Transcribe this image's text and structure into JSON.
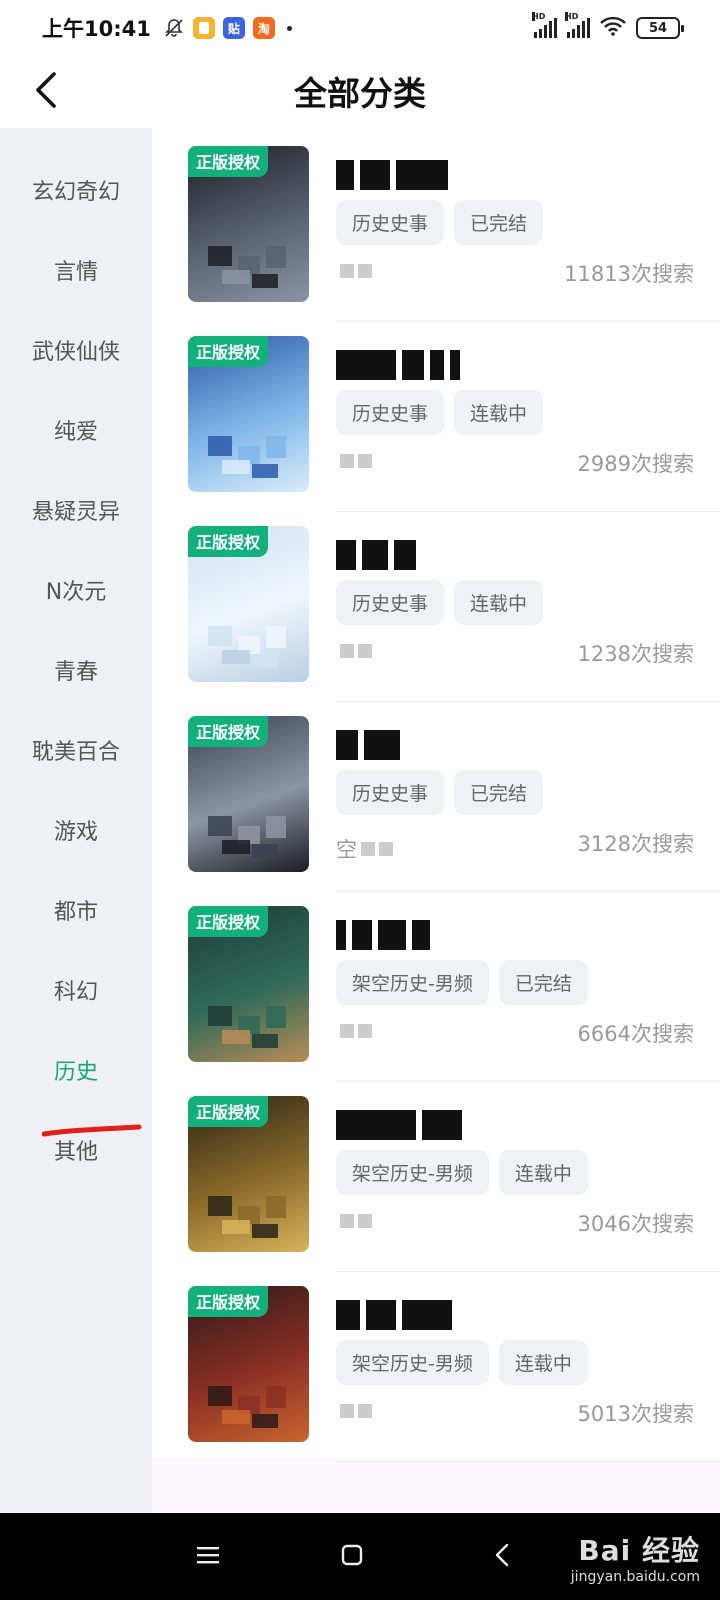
{
  "status_bar": {
    "time": "上午10:41",
    "app_icons": [
      {
        "name": "notes-app-icon",
        "label": "",
        "color": "#f6b531"
      },
      {
        "name": "tieba-app-icon",
        "label": "贴",
        "color": "#3d63e0"
      },
      {
        "name": "taobao-app-icon",
        "label": "淘",
        "color": "#f26b1d"
      }
    ],
    "battery": "54"
  },
  "header": {
    "title": "全部分类"
  },
  "sidebar": {
    "items": [
      {
        "label": "玄幻奇幻",
        "active": false
      },
      {
        "label": "言情",
        "active": false
      },
      {
        "label": "武侠仙侠",
        "active": false
      },
      {
        "label": "纯爱",
        "active": false
      },
      {
        "label": "悬疑灵异",
        "active": false
      },
      {
        "label": "N次元",
        "active": false
      },
      {
        "label": "青春",
        "active": false
      },
      {
        "label": "耽美百合",
        "active": false
      },
      {
        "label": "游戏",
        "active": false
      },
      {
        "label": "都市",
        "active": false
      },
      {
        "label": "科幻",
        "active": false
      },
      {
        "label": "历史",
        "active": true
      },
      {
        "label": "其他",
        "active": false
      }
    ],
    "active_color": "#19a67d"
  },
  "books": [
    {
      "badge": "正版授权",
      "tags": [
        "历史史事",
        "已完结"
      ],
      "author": "",
      "search_count": "11813次搜索",
      "cover_colors": [
        "#1c1f26",
        "#5a6270",
        "#8a94a3"
      ]
    },
    {
      "badge": "正版授权",
      "tags": [
        "历史史事",
        "连载中"
      ],
      "author": "",
      "search_count": "2989次搜索",
      "cover_colors": [
        "#2c5aa8",
        "#7fb6e8",
        "#d9ecfa"
      ]
    },
    {
      "badge": "正版授权",
      "tags": [
        "历史史事",
        "连载中"
      ],
      "author": "",
      "search_count": "1238次搜索",
      "cover_colors": [
        "#cfe3f2",
        "#eef6fb",
        "#b9cfe3"
      ]
    },
    {
      "badge": "正版授权",
      "tags": [
        "历史史事",
        "已完结"
      ],
      "author": "空",
      "search_count": "3128次搜索",
      "cover_colors": [
        "#3a4150",
        "#8d95a3",
        "#1a1c22"
      ]
    },
    {
      "badge": "正版授权",
      "tags": [
        "架空历史-男频",
        "已完结"
      ],
      "author": "",
      "search_count": "6664次搜索",
      "cover_colors": [
        "#1f3b35",
        "#2f6a58",
        "#b98c55"
      ]
    },
    {
      "badge": "正版授权",
      "tags": [
        "架空历史-男频",
        "连载中"
      ],
      "author": "",
      "search_count": "3046次搜索",
      "cover_colors": [
        "#2a2418",
        "#8a6a2a",
        "#d8b25a"
      ]
    },
    {
      "badge": "正版授权",
      "tags": [
        "架空历史-男频",
        "连载中"
      ],
      "author": "",
      "search_count": "5013次搜索",
      "cover_colors": [
        "#2c1a18",
        "#8a2f24",
        "#c9652e"
      ]
    }
  ],
  "nav": {
    "watermark_main": "Bai 经验",
    "watermark_sub": "jingyan.baidu.com"
  }
}
